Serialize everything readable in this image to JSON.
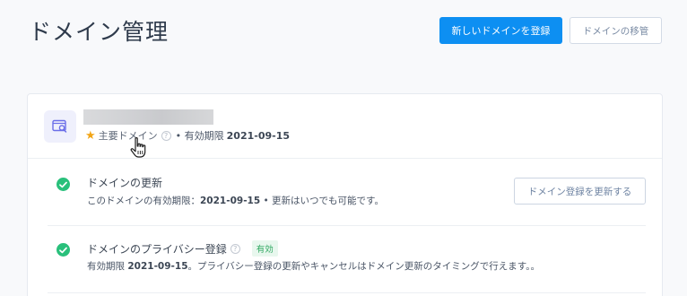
{
  "header": {
    "title": "ドメイン管理",
    "register_button": "新しいドメインを登録",
    "transfer_button": "ドメインの移管"
  },
  "domain": {
    "primary_label": "主要ドメイン",
    "help_glyph": "?",
    "expiry_prefix": "• 有効期限",
    "expiry_date": "2021-09-15"
  },
  "rows": [
    {
      "title": "ドメインの更新",
      "desc_prefix": "このドメインの有効期限：",
      "desc_date": "2021-09-15",
      "desc_suffix": " • 更新はいつでも可能です。",
      "button": "ドメイン登録を更新する"
    },
    {
      "title": "ドメインのプライバシー登録",
      "badge": "有効",
      "desc_prefix": "有効期限 ",
      "desc_date": "2021-09-15",
      "desc_suffix": "。プライバシー登録の更新やキャンセルはドメイン更新のタイミングで行えます。。"
    }
  ],
  "colors": {
    "accent": "#0d8ff2",
    "success": "#29c07b",
    "star": "#f2a516"
  },
  "icons": [
    "domain-search-icon",
    "star-icon",
    "help-icon",
    "check-circle-icon",
    "hand-pointer-cursor"
  ]
}
